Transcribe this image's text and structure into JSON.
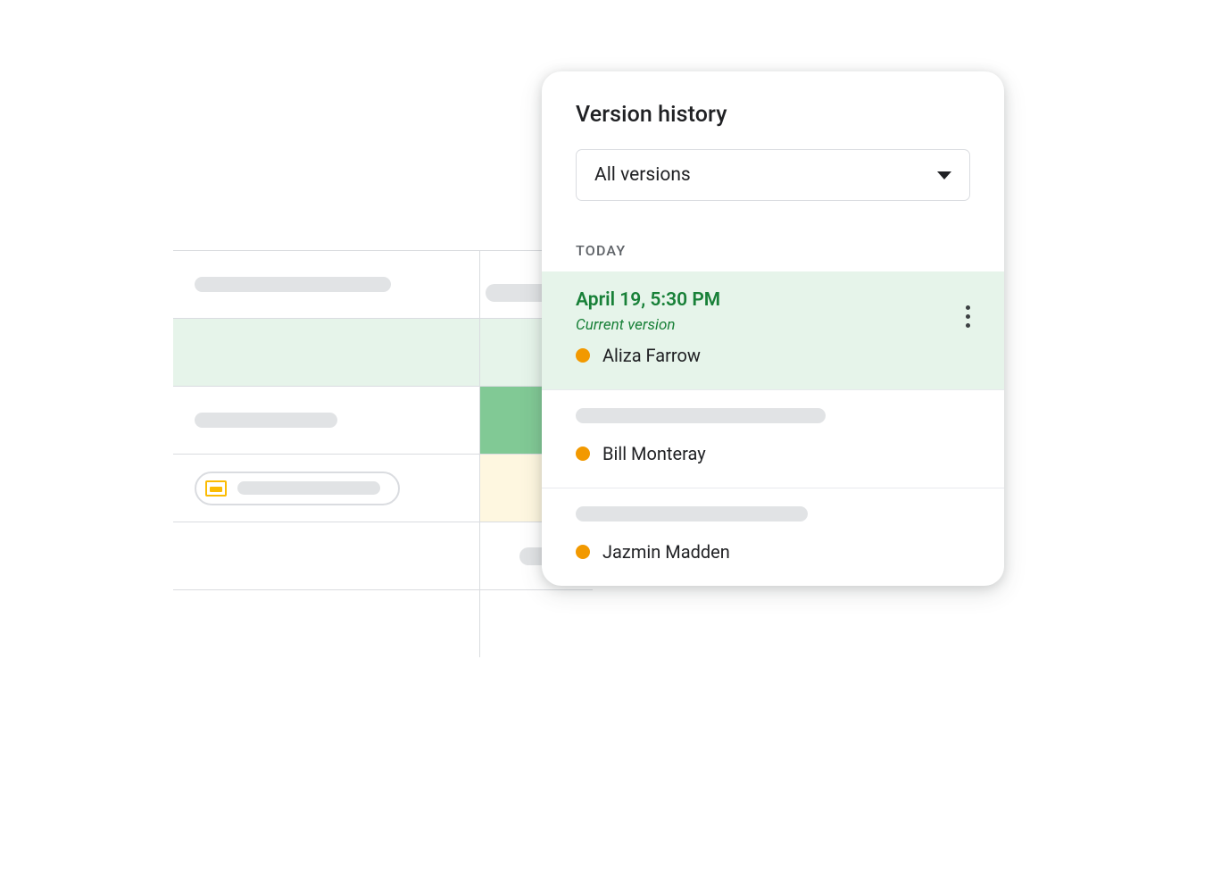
{
  "panel": {
    "title": "Version history",
    "dropdown_label": "All versions",
    "section_label": "TODAY",
    "items": [
      {
        "timestamp": "April 19, 5:30 PM",
        "subtitle": "Current version",
        "contributor": "Aliza Farrow",
        "dot_color": "#f29900",
        "current": true
      },
      {
        "timestamp": null,
        "subtitle": null,
        "contributor": "Bill Monteray",
        "dot_color": "#f29900",
        "current": false
      },
      {
        "timestamp": null,
        "subtitle": null,
        "contributor": "Jazmin Madden",
        "dot_color": "#f29900",
        "current": false
      }
    ]
  }
}
